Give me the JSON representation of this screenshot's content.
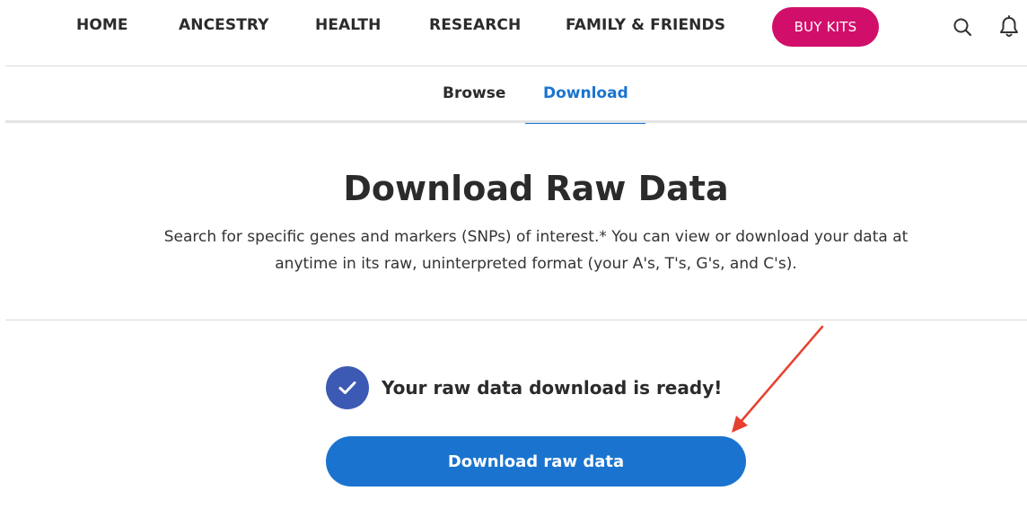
{
  "nav": {
    "items": [
      {
        "label": "HOME"
      },
      {
        "label": "ANCESTRY"
      },
      {
        "label": "HEALTH"
      },
      {
        "label": "RESEARCH"
      },
      {
        "label": "FAMILY & FRIENDS"
      }
    ],
    "buy_kits_label": "BUY KITS",
    "icons": [
      "search-icon",
      "bell-icon"
    ]
  },
  "tabs": {
    "items": [
      {
        "label": "Browse",
        "active": false
      },
      {
        "label": "Download",
        "active": true
      }
    ]
  },
  "main": {
    "title": "Download Raw Data",
    "description_line1": "Search for specific genes and markers (SNPs) of interest.* You can view or download your data at",
    "description_line2": "anytime in its raw, uninterpreted format (your A's, T's, G's, and C's).",
    "status_text": "Your raw data download is ready!",
    "download_button_label": "Download raw data"
  },
  "colors": {
    "accent_blue": "#1a74cf",
    "brand_pink": "#d10f6b",
    "check_blue": "#3c5ab3",
    "annotation_red": "#e8402f"
  }
}
